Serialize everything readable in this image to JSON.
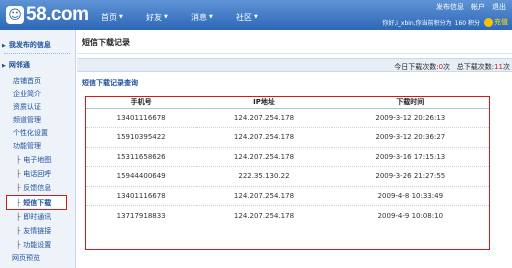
{
  "header": {
    "logo_text": "58.com",
    "logo_icon": "58-logo-icon",
    "nav": [
      {
        "label": "首页"
      },
      {
        "label": "好友"
      },
      {
        "label": "消息"
      },
      {
        "label": "社区"
      }
    ],
    "top_links": [
      "发布信息",
      "帐户",
      "退出"
    ],
    "user_text": "你好,i_xbin,你当前积分为",
    "credits": "160 积分",
    "recharge_label": "充值"
  },
  "sidebar": {
    "my_posts": "我发布的信息",
    "shop": "网邻通",
    "items": [
      "店铺首页",
      "企业简介",
      "资质认证",
      "频道管理",
      "个性化设置",
      "功能管理"
    ],
    "sub_items": [
      "电子地图",
      "电话回呼",
      "反馈信息",
      "短信下载",
      "即时通讯",
      "友情链接",
      "功能设置"
    ],
    "bottom": "网页预览"
  },
  "main": {
    "title": "短信下载记录",
    "counts": {
      "today_label": "今日下载次数:",
      "today_value": "0",
      "today_unit": "次",
      "total_label": "总下载次数:",
      "total_value": "11",
      "total_unit": "次"
    },
    "query_title": "短信下载记录查询",
    "table": {
      "columns": [
        "手机号",
        "IP地址",
        "下载时间"
      ],
      "rows": [
        [
          "13401116678",
          "124.207.254.178",
          "2009-3-12 20:26:13"
        ],
        [
          "15910395422",
          "124.207.254.178",
          "2009-3-12 20:36:27"
        ],
        [
          "15311658626",
          "124.207.254.178",
          "2009-3-16 17:15:13"
        ],
        [
          "15944400649",
          "222.35.130.22",
          "2009-3-26 21:27:55"
        ],
        [
          "13401116678",
          "124.207.254.178",
          "2009-4-8 10:33:49"
        ],
        [
          "13717918833",
          "124.207.254.178",
          "2009-4-9 10:08:10"
        ]
      ]
    }
  }
}
